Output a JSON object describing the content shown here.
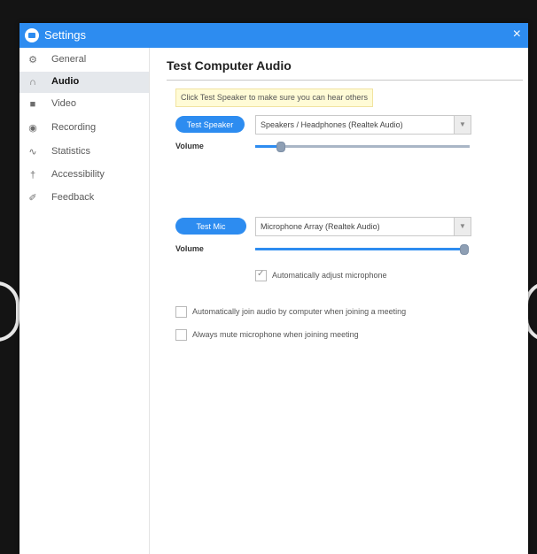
{
  "window": {
    "title": "Settings",
    "close_glyph": "×"
  },
  "sidebar": {
    "items": [
      {
        "label": "General",
        "icon": "gear-icon",
        "glyph": "⚙",
        "active": false
      },
      {
        "label": "Audio",
        "icon": "headphones-icon",
        "glyph": "∩",
        "active": true
      },
      {
        "label": "Video",
        "icon": "video-camera-icon",
        "glyph": "■",
        "active": false
      },
      {
        "label": "Recording",
        "icon": "record-icon",
        "glyph": "◉",
        "active": false
      },
      {
        "label": "Statistics",
        "icon": "statistics-icon",
        "glyph": "∿",
        "active": false
      },
      {
        "label": "Accessibility",
        "icon": "accessibility-icon",
        "glyph": "†",
        "active": false
      },
      {
        "label": "Feedback",
        "icon": "feedback-icon",
        "glyph": "✐",
        "active": false
      }
    ]
  },
  "main": {
    "title": "Test Computer Audio",
    "hint": "Click Test Speaker to make sure you can hear others",
    "speaker": {
      "button": "Test Speaker",
      "device": "Speakers / Headphones (Realtek Audio)",
      "volume_label": "Volume",
      "volume_level": 0.12
    },
    "mic": {
      "button": "Test Mic",
      "device": "Microphone Array (Realtek Audio)",
      "volume_label": "Volume",
      "volume_level": 1.0,
      "auto_adjust": {
        "label": "Automatically adjust microphone",
        "checked": true
      }
    },
    "options": [
      {
        "label": "Automatically join audio by computer when joining a meeting",
        "checked": false
      },
      {
        "label": "Always mute microphone when joining meeting",
        "checked": false
      }
    ]
  },
  "colors": {
    "accent": "#2d8cf0",
    "backdrop": "#141414",
    "active_nav_bg": "#e5e8ec",
    "hint_bg": "#fffbd6",
    "slider_track": "#a9b6c6"
  }
}
